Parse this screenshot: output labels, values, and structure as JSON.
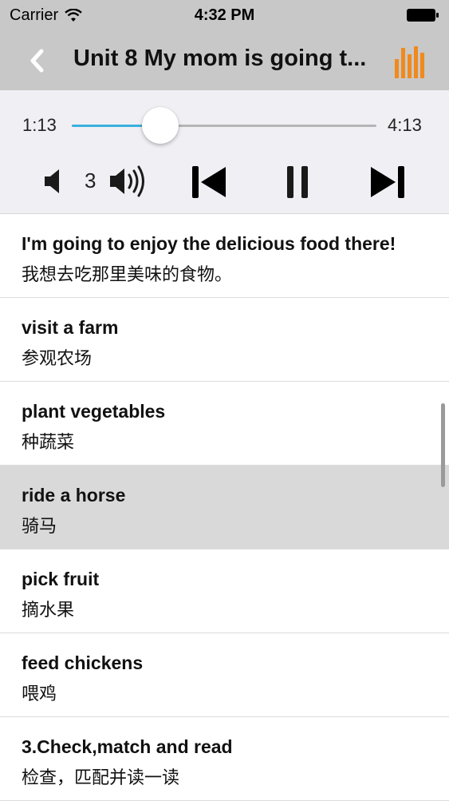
{
  "status_bar": {
    "carrier": "Carrier",
    "time": "4:32 PM"
  },
  "nav": {
    "title": "Unit 8 My mom is going t...",
    "back_icon": "chevron-left-icon",
    "right_icon": "bars-icon",
    "accent": "#f08a1c"
  },
  "player": {
    "current_time": "1:13",
    "duration": "4:13",
    "progress": 0.29,
    "volume": "3",
    "track_color": "#3ab0de"
  },
  "list": {
    "items": [
      {
        "en": "I'm going to enjoy the delicious food there!",
        "cn": "我想去吃那里美味的食物。",
        "selected": false
      },
      {
        "en": "visit a farm",
        "cn": "参观农场",
        "selected": false
      },
      {
        "en": "plant vegetables",
        "cn": "种蔬菜",
        "selected": false
      },
      {
        "en": "ride a horse",
        "cn": "骑马",
        "selected": true
      },
      {
        "en": "pick fruit",
        "cn": "摘水果",
        "selected": false
      },
      {
        "en": "feed chickens",
        "cn": "喂鸡",
        "selected": false
      },
      {
        "en": "3.Check,match and read",
        "cn": "检查，匹配并读一读",
        "selected": false
      }
    ]
  }
}
